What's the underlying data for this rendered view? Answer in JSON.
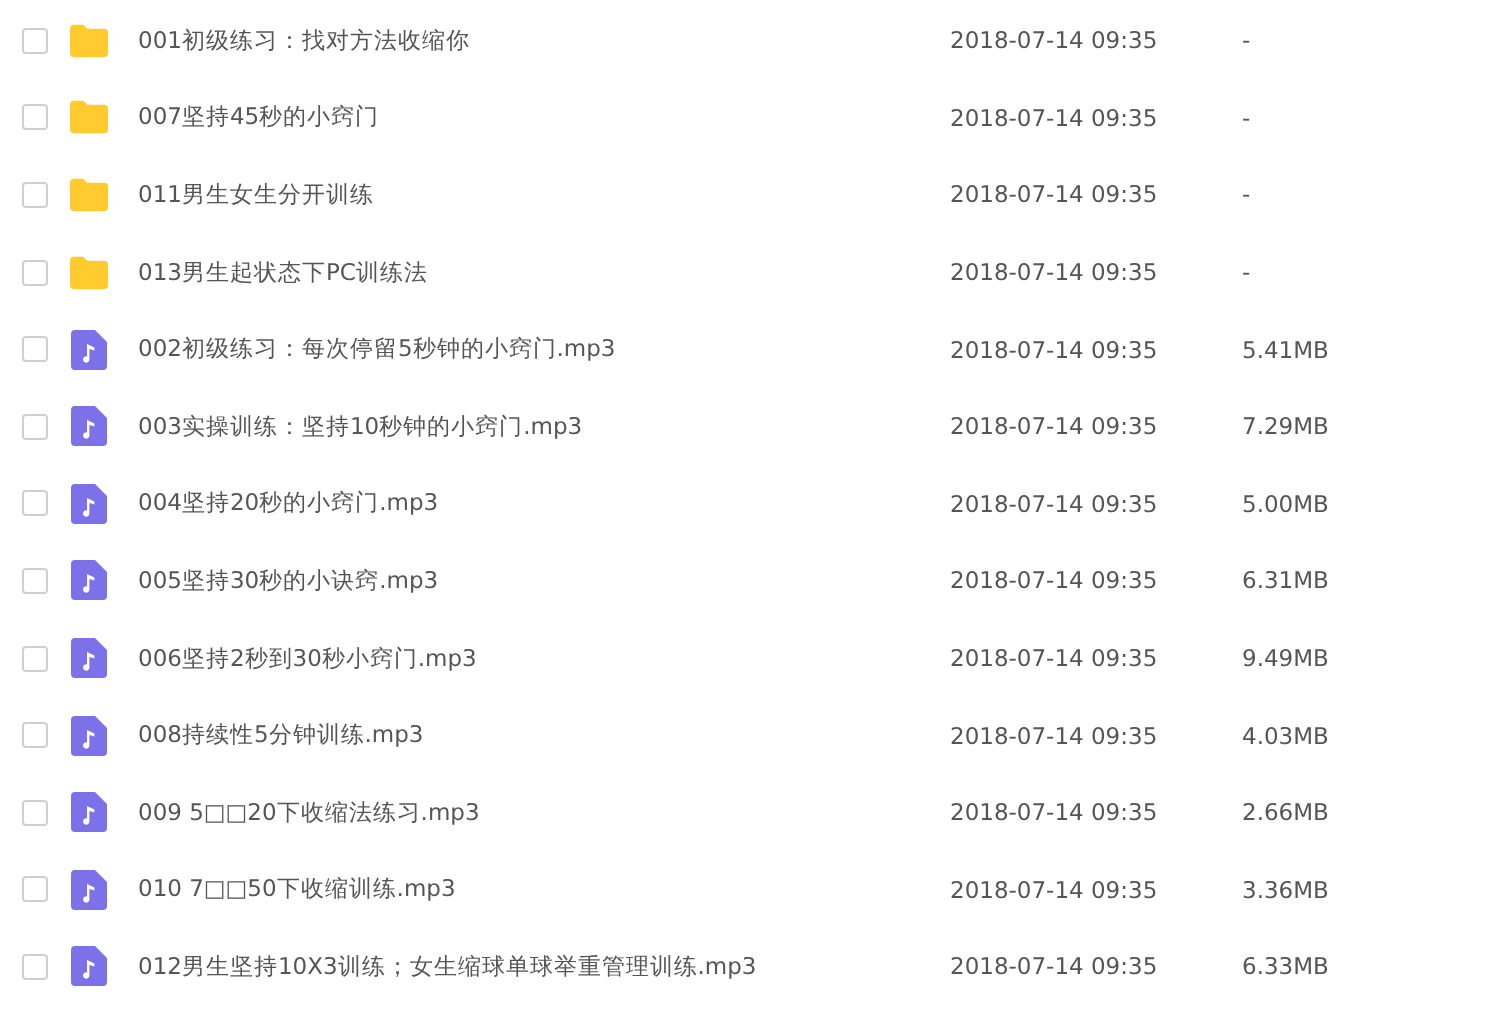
{
  "files": [
    {
      "kind": "folder",
      "name": "001初级练习：找对方法收缩你",
      "date": "2018-07-14 09:35",
      "size": "-",
      "checked": false
    },
    {
      "kind": "folder",
      "name": "007坚持45秒的小窍门",
      "date": "2018-07-14 09:35",
      "size": "-",
      "checked": false
    },
    {
      "kind": "folder",
      "name": "011男生女生分开训练",
      "date": "2018-07-14 09:35",
      "size": "-",
      "checked": false
    },
    {
      "kind": "folder",
      "name": "013男生起状态下PC训练法",
      "date": "2018-07-14 09:35",
      "size": "-",
      "checked": false
    },
    {
      "kind": "audio",
      "name": "002初级练习：每次停留5秒钟的小窍门.mp3",
      "date": "2018-07-14 09:35",
      "size": "5.41MB",
      "checked": false
    },
    {
      "kind": "audio",
      "name": "003实操训练：坚持10秒钟的小窍门.mp3",
      "date": "2018-07-14 09:35",
      "size": "7.29MB",
      "checked": false
    },
    {
      "kind": "audio",
      "name": "004坚持20秒的小窍门.mp3",
      "date": "2018-07-14 09:35",
      "size": "5.00MB",
      "checked": false
    },
    {
      "kind": "audio",
      "name": "005坚持30秒的小诀窍.mp3",
      "date": "2018-07-14 09:35",
      "size": "6.31MB",
      "checked": false
    },
    {
      "kind": "audio",
      "name": "006坚持2秒到30秒小窍门.mp3",
      "date": "2018-07-14 09:35",
      "size": "9.49MB",
      "checked": false
    },
    {
      "kind": "audio",
      "name": "008持续性5分钟训练.mp3",
      "date": "2018-07-14 09:35",
      "size": "4.03MB",
      "checked": false
    },
    {
      "kind": "audio",
      "name": "009 5□□20下收缩法练习.mp3",
      "date": "2018-07-14 09:35",
      "size": "2.66MB",
      "checked": false
    },
    {
      "kind": "audio",
      "name": "010 7□□50下收缩训练.mp3",
      "date": "2018-07-14 09:35",
      "size": "3.36MB",
      "checked": false
    },
    {
      "kind": "audio",
      "name": "012男生坚持10X3训练；女生缩球单球举重管理训练.mp3",
      "date": "2018-07-14 09:35",
      "size": "6.33MB",
      "checked": false
    }
  ]
}
